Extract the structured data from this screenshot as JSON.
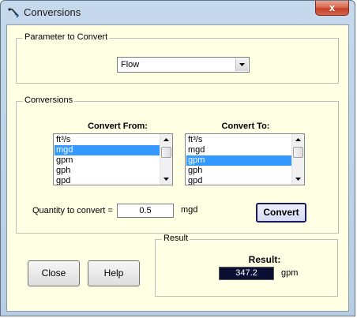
{
  "window": {
    "title": "Conversions",
    "close_glyph": "x",
    "icon": "app-icon"
  },
  "parameter_group": {
    "label": "Parameter to Convert",
    "selected": "Flow"
  },
  "conversions_group": {
    "label": "Conversions",
    "from": {
      "heading": "Convert From:",
      "items": [
        "ft³/s",
        "mgd",
        "gpm",
        "gph",
        "gpd"
      ],
      "selected_index": 1
    },
    "to": {
      "heading": "Convert To:",
      "items": [
        "ft³/s",
        "mgd",
        "gpm",
        "gph",
        "gpd"
      ],
      "selected_index": 2
    },
    "quantity_label": "Quantity to convert =",
    "quantity_value": "0.5",
    "quantity_unit": "mgd",
    "convert_label": "Convert"
  },
  "buttons": {
    "close_label": "Close",
    "help_label": "Help"
  },
  "result_group": {
    "label": "Result",
    "heading": "Result:",
    "value": "347.2",
    "unit": "gpm"
  },
  "colors": {
    "selection": "#3399ff",
    "client_background": "#ffffe4",
    "result_background": "#0b1033"
  }
}
